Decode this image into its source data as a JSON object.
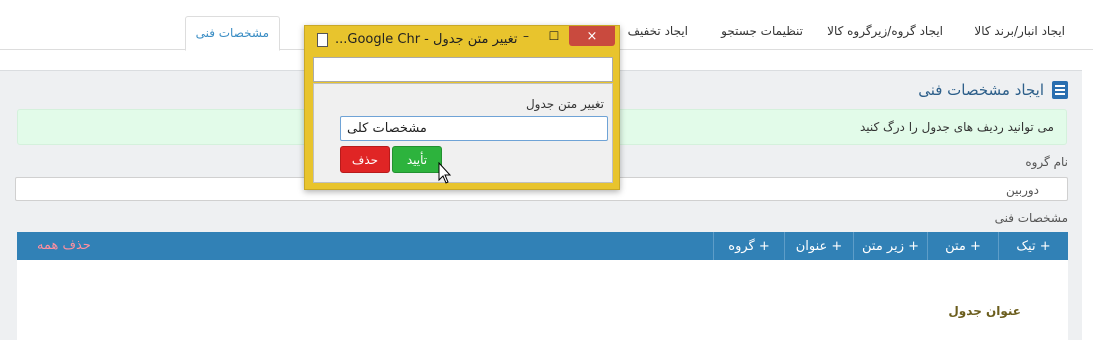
{
  "tabs": [
    {
      "label": "ایجاد انبار/برند کالا",
      "active": false
    },
    {
      "label": "ایجاد گروه/زیرگروه کالا",
      "active": false
    },
    {
      "label": "تنظیمات جستجو",
      "active": false
    },
    {
      "label": "ایجاد تخفیف",
      "active": false
    },
    {
      "label": "مشخصات فنی",
      "active": true
    }
  ],
  "panel": {
    "title": "ایجاد مشخصات فنی",
    "notice": "می توانید ردیف های جدول را درگ کنید",
    "group_label": "نام گروه",
    "group_value": "دوربین",
    "specs_label": "مشخصات فنی",
    "table": {
      "columns": [
        "+ تیک",
        "+ متن",
        "+ زیر متن",
        "+ عنوان",
        "+ گروه"
      ],
      "delete_all": "حذف همه",
      "row_title": "عنوان جدول"
    }
  },
  "dialog": {
    "title": "تغییر متن جدول - Google Chr...",
    "label": "تغییر متن جدول",
    "input_value": "مشخصات کلی",
    "ok": "تأیید",
    "delete": "حذف",
    "win_min": "–",
    "win_max": "☐",
    "win_close": "×"
  },
  "colors": {
    "header_blue": "#3181b6",
    "notice_green": "#e2fbe9",
    "dialog_frame": "#e8c42d",
    "ok_green": "#2db33d",
    "delete_red": "#e02525"
  }
}
